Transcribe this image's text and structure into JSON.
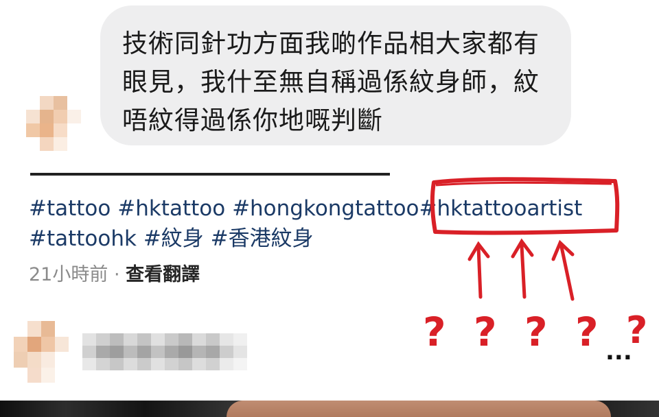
{
  "comment": {
    "text": "技術同針功方面我啲作品相大家都有眼見，我什至無自稱過係紋身師，紋唔紋得過係你地嘅判斷"
  },
  "post": {
    "divider": "——————————————",
    "hashtags": {
      "tattoo": "#tattoo",
      "hktattoo": "#hktattoo",
      "hongkongtattoo": "#hongkongtattoo",
      "hktattooartist": "#hktattooartist",
      "tattoohk": "#tattoohk",
      "tattoo_zh": "#紋身",
      "hk_tattoo_zh": "#香港紋身"
    },
    "time": "21小時前",
    "separator": "·",
    "translate": "查看翻譯"
  },
  "annotation": {
    "question_marks": [
      "?",
      "?",
      "?",
      "?",
      "?"
    ],
    "ellipsis": "...",
    "color": "#d92027"
  },
  "colors": {
    "bubble": "#eeeeef",
    "hashtag": "#1b3a66",
    "meta": "#8a8a8a"
  }
}
